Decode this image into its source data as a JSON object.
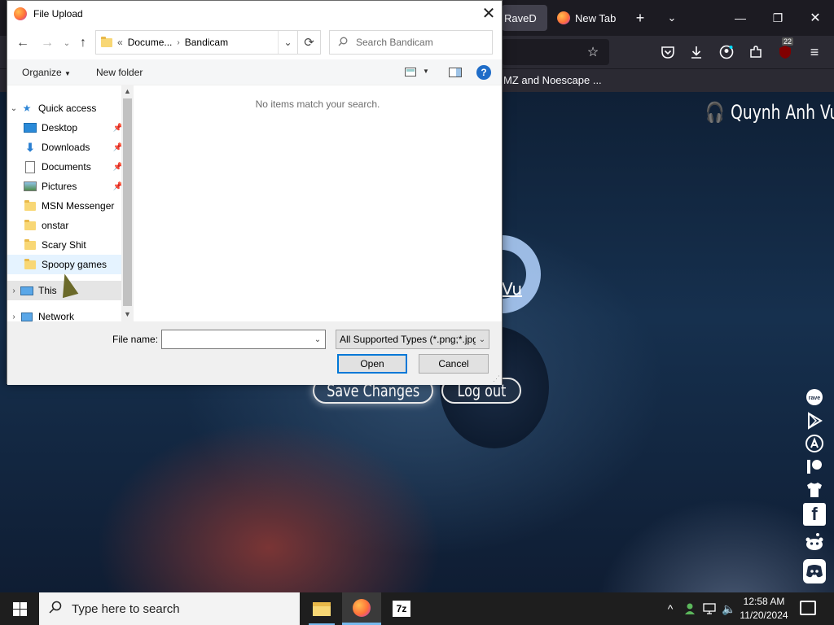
{
  "browser": {
    "tab_partial_label": "RaveD",
    "tab_newtab_label": "New Tab",
    "bookmark_label": "MZ and Noescape ...",
    "extension_badge": "22"
  },
  "page": {
    "username": "Quynh Anh Vu",
    "username_partial": "Vu",
    "save_button": "Save Changes",
    "logout_button": "Log out",
    "social_icons": [
      "rave-icon",
      "google-play-icon",
      "app-store-icon",
      "patreon-icon",
      "merch-shirt-icon",
      "facebook-icon",
      "reddit-icon",
      "discord-icon"
    ]
  },
  "dialog": {
    "title": "File Upload",
    "breadcrumb": [
      "Docume...",
      "Bandicam"
    ],
    "breadcrumb_prefix": "«",
    "search_placeholder": "Search Bandicam",
    "organize_label": "Organize",
    "new_folder_label": "New folder",
    "empty_message": "No items match your search.",
    "tree": [
      {
        "label": "Quick access",
        "icon": "star-icon",
        "pinned": false
      },
      {
        "label": "Desktop",
        "icon": "desktop-icon",
        "pinned": true
      },
      {
        "label": "Downloads",
        "icon": "download-icon",
        "pinned": true
      },
      {
        "label": "Documents",
        "icon": "document-icon",
        "pinned": true
      },
      {
        "label": "Pictures",
        "icon": "pictures-icon",
        "pinned": true
      },
      {
        "label": "MSN Messenger",
        "icon": "folder-icon",
        "pinned": false
      },
      {
        "label": "onstar",
        "icon": "folder-icon",
        "pinned": false
      },
      {
        "label": "Scary Shit",
        "icon": "folder-icon",
        "pinned": false
      },
      {
        "label": "Spoopy games",
        "icon": "folder-icon",
        "pinned": false
      },
      {
        "label": "This",
        "icon": "computer-icon",
        "pinned": false
      },
      {
        "label": "Network",
        "icon": "network-icon",
        "pinned": false
      }
    ],
    "file_name_label": "File name:",
    "file_name_value": "",
    "file_type_value": "All Supported Types (*.png;*.jpg",
    "open_button": "Open",
    "cancel_button": "Cancel"
  },
  "taskbar": {
    "search_placeholder": "Type here to search",
    "time": "12:58 AM",
    "date": "11/20/2024",
    "sevenzip_label": "7z"
  }
}
